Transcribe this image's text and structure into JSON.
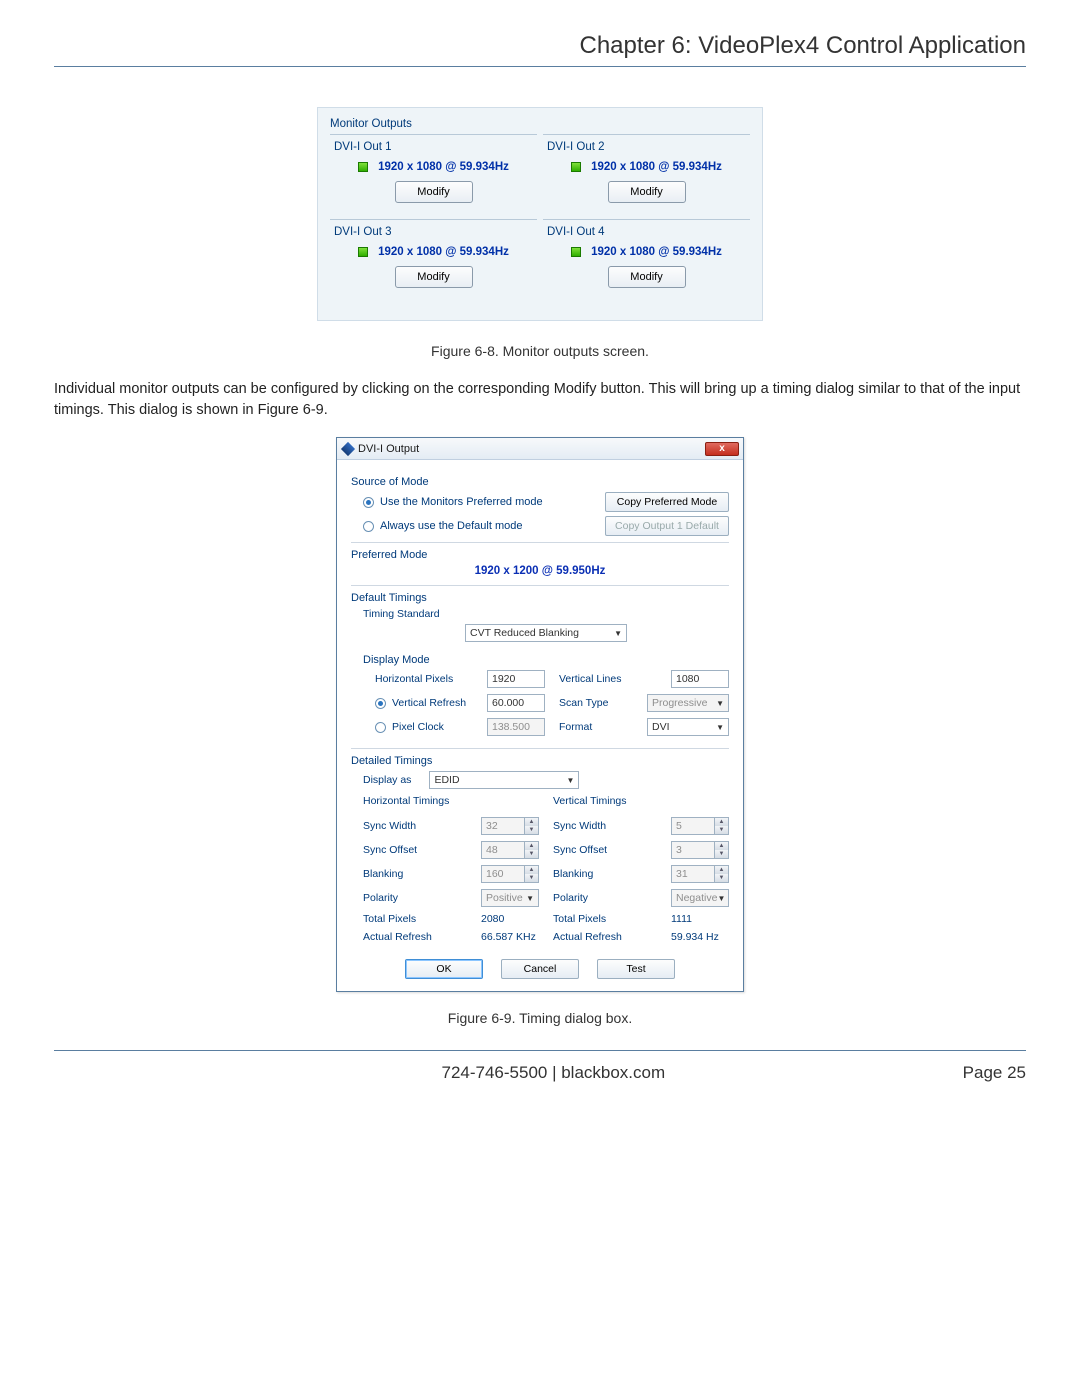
{
  "header": {
    "chapter_title": "Chapter 6: VideoPlex4 Control Application"
  },
  "monitor_panel": {
    "group_label": "Monitor Outputs",
    "outputs": [
      {
        "label": "DVI-I Out 1",
        "resolution": "1920 x 1080 @ 59.934Hz",
        "modify": "Modify"
      },
      {
        "label": "DVI-I Out 2",
        "resolution": "1920 x 1080 @ 59.934Hz",
        "modify": "Modify"
      },
      {
        "label": "DVI-I Out 3",
        "resolution": "1920 x 1080 @ 59.934Hz",
        "modify": "Modify"
      },
      {
        "label": "DVI-I Out 4",
        "resolution": "1920 x 1080 @ 59.934Hz",
        "modify": "Modify"
      }
    ]
  },
  "caption1": "Figure 6-8. Monitor outputs screen.",
  "paragraph": "Individual monitor outputs can be configured by clicking on the corresponding Modify button. This will bring up a timing dialog similar to that of the input timings. This dialog is shown in Figure 6-9.",
  "dialog": {
    "title": "DVI-I Output",
    "close_glyph": "x",
    "source_of_mode": {
      "label": "Source of Mode",
      "opt_preferred": "Use the Monitors Preferred mode",
      "opt_default": "Always use the Default mode",
      "btn_copy_preferred": "Copy Preferred Mode",
      "btn_copy_default": "Copy Output 1 Default"
    },
    "preferred_mode": {
      "label": "Preferred Mode",
      "value": "1920 x 1200 @ 59.950Hz"
    },
    "default_timings": {
      "label": "Default Timings",
      "timing_standard_label": "Timing Standard",
      "timing_standard_value": "CVT Reduced Blanking",
      "display_mode_label": "Display Mode",
      "horizontal_pixels_label": "Horizontal Pixels",
      "horizontal_pixels_value": "1920",
      "vertical_lines_label": "Vertical Lines",
      "vertical_lines_value": "1080",
      "vertical_refresh_label": "Vertical Refresh",
      "vertical_refresh_value": "60.000",
      "scan_type_label": "Scan Type",
      "scan_type_value": "Progressive",
      "pixel_clock_label": "Pixel Clock",
      "pixel_clock_value": "138.500",
      "format_label": "Format",
      "format_value": "DVI"
    },
    "detailed_timings": {
      "label": "Detailed Timings",
      "display_as_label": "Display as",
      "display_as_value": "EDID",
      "h_label": "Horizontal Timings",
      "v_label": "Vertical Timings",
      "sync_width_label": "Sync Width",
      "h_sync_width": "32",
      "v_sync_width": "5",
      "sync_offset_label": "Sync Offset",
      "h_sync_offset": "48",
      "v_sync_offset": "3",
      "blanking_label": "Blanking",
      "h_blanking": "160",
      "v_blanking": "31",
      "polarity_label": "Polarity",
      "h_polarity": "Positive",
      "v_polarity": "Negative",
      "total_pixels_label": "Total Pixels",
      "h_total_pixels": "2080",
      "v_total_pixels": "1111",
      "actual_refresh_label": "Actual Refresh",
      "h_actual_refresh": "66.587 KHz",
      "v_actual_refresh": "59.934 Hz"
    },
    "buttons": {
      "ok": "OK",
      "cancel": "Cancel",
      "test": "Test"
    }
  },
  "caption2": "Figure 6-9. Timing dialog box.",
  "footer": {
    "center": "724-746-5500   |   blackbox.com",
    "page": "Page 25"
  }
}
